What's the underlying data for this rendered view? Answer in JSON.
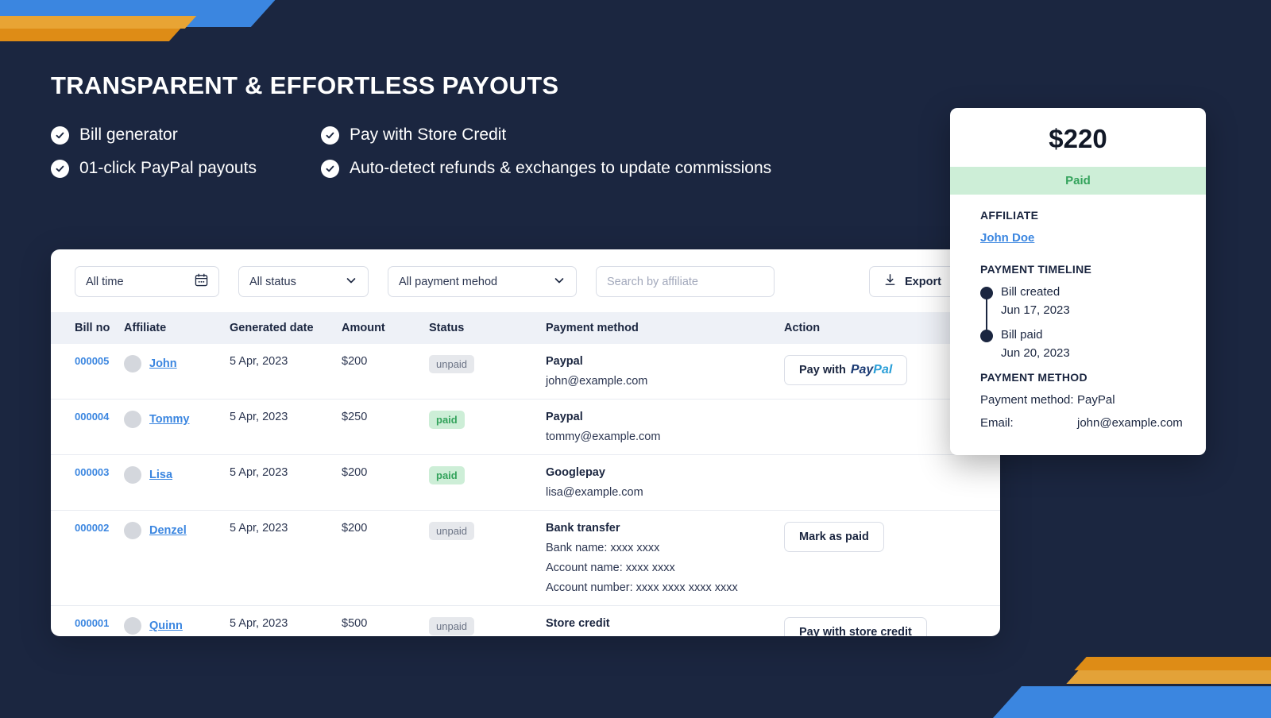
{
  "theme": {
    "background": "#1b2640",
    "accent_blue": "#3b86e0",
    "accent_orange": "#de8c16",
    "paid_green": "#34a35c",
    "paid_green_bg": "#cdeed7"
  },
  "hero": {
    "headline": "TRANSPARENT & EFFORTLESS PAYOUTS",
    "features": [
      "Bill generator",
      "Pay with Store Credit",
      "01-click PayPal payouts",
      "Auto-detect refunds & exchanges to update commissions"
    ]
  },
  "filters": {
    "time": "All time",
    "time_icon": "calendar-icon",
    "status": "All status",
    "status_icon": "chevron-down-icon",
    "method": "All payment mehod",
    "method_icon": "chevron-down-icon",
    "search_placeholder": "Search by affiliate",
    "search_value": "",
    "export_label": "Export",
    "export_icon": "download-icon"
  },
  "table": {
    "headers": [
      "Bill no",
      "Affiliate",
      "Generated date",
      "Amount",
      "Status",
      "Payment method",
      "Action"
    ],
    "rows": [
      {
        "bill_no": "000005",
        "affiliate": "John",
        "generated_date": "5 Apr, 2023",
        "amount": "$200",
        "status": "unpaid",
        "payment_method": "Paypal",
        "payment_details": [
          "john@example.com"
        ],
        "action": "Pay with PayPal",
        "action_type": "paypal"
      },
      {
        "bill_no": "000004",
        "affiliate": "Tommy",
        "generated_date": "5 Apr, 2023",
        "amount": "$250",
        "status": "paid",
        "payment_method": "Paypal",
        "payment_details": [
          "tommy@example.com"
        ],
        "action": "",
        "action_type": "none"
      },
      {
        "bill_no": "000003",
        "affiliate": "Lisa",
        "generated_date": "5 Apr, 2023",
        "amount": "$200",
        "status": "paid",
        "payment_method": "Googlepay",
        "payment_details": [
          "lisa@example.com"
        ],
        "action": "",
        "action_type": "none"
      },
      {
        "bill_no": "000002",
        "affiliate": "Denzel",
        "generated_date": "5 Apr, 2023",
        "amount": "$200",
        "status": "unpaid",
        "payment_method": "Bank transfer",
        "payment_details": [
          "Bank name: xxxx xxxx",
          "Account name: xxxx xxxx",
          "Account number: xxxx xxxx xxxx xxxx"
        ],
        "action": "Mark as paid",
        "action_type": "text"
      },
      {
        "bill_no": "000001",
        "affiliate": "Quinn",
        "generated_date": "5 Apr, 2023",
        "amount": "$500",
        "status": "unpaid",
        "payment_method": "Store credit",
        "payment_details": [],
        "action": "Pay with store credit",
        "action_type": "text"
      }
    ]
  },
  "detail": {
    "amount": "$220",
    "status": "Paid",
    "affiliate_title": "AFFILIATE",
    "affiliate_name": "John Doe",
    "timeline_title": "PAYMENT TIMELINE",
    "timeline": [
      {
        "label": "Bill created",
        "date": "Jun 17, 2023"
      },
      {
        "label": "Bill paid",
        "date": "Jun 20, 2023"
      }
    ],
    "method_title": "PAYMENT METHOD",
    "method_key": "Payment method:",
    "method_value": "PayPal",
    "email_key": "Email:",
    "email_value": "john@example.com"
  }
}
